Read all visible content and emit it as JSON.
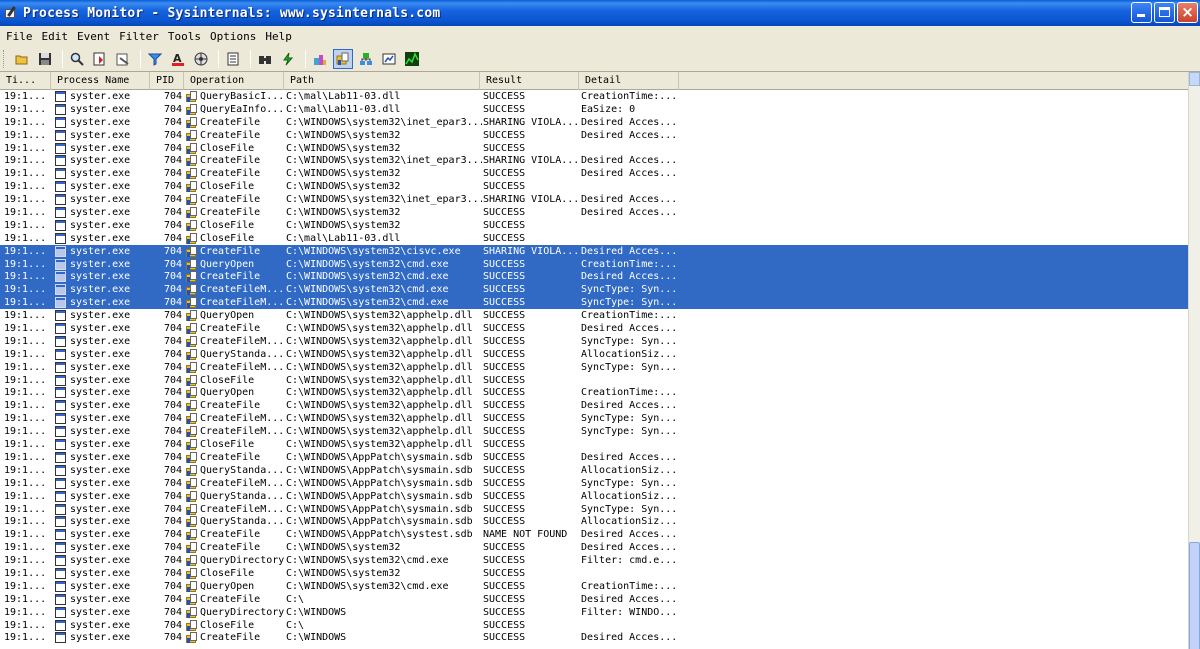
{
  "window": {
    "title": "Process Monitor - Sysinternals: www.sysinternals.com"
  },
  "menu": [
    "File",
    "Edit",
    "Event",
    "Filter",
    "Tools",
    "Options",
    "Help"
  ],
  "toolbar": {
    "buttons": [
      "open-folder-icon",
      "save-icon",
      "magnify-icon",
      "autoscroll-icon",
      "clear-icon",
      "filter-icon",
      "highlight-icon",
      "network-icon",
      "properties-icon",
      "find-icon",
      "jump-icon",
      "registry-icon",
      "filesystem-icon",
      "network-activity-icon",
      "process-activity-icon",
      "profiling-icon"
    ],
    "active_index": 12
  },
  "columns": [
    "Ti...",
    "Process Name",
    "PID",
    "Operation",
    "Path",
    "Result",
    "Detail"
  ],
  "rows": [
    {
      "time": "19:1...",
      "proc": "syster.exe",
      "pid": "704",
      "op": "QueryBasicI...",
      "path": "C:\\mal\\Lab11-03.dll",
      "result": "SUCCESS",
      "detail": "CreationTime:..."
    },
    {
      "time": "19:1...",
      "proc": "syster.exe",
      "pid": "704",
      "op": "QueryEaInfo...",
      "path": "C:\\mal\\Lab11-03.dll",
      "result": "SUCCESS",
      "detail": "EaSize: 0"
    },
    {
      "time": "19:1...",
      "proc": "syster.exe",
      "pid": "704",
      "op": "CreateFile",
      "path": "C:\\WINDOWS\\system32\\inet_epar3...",
      "result": "SHARING VIOLA...",
      "detail": "Desired Acces..."
    },
    {
      "time": "19:1...",
      "proc": "syster.exe",
      "pid": "704",
      "op": "CreateFile",
      "path": "C:\\WINDOWS\\system32",
      "result": "SUCCESS",
      "detail": "Desired Acces..."
    },
    {
      "time": "19:1...",
      "proc": "syster.exe",
      "pid": "704",
      "op": "CloseFile",
      "path": "C:\\WINDOWS\\system32",
      "result": "SUCCESS",
      "detail": ""
    },
    {
      "time": "19:1...",
      "proc": "syster.exe",
      "pid": "704",
      "op": "CreateFile",
      "path": "C:\\WINDOWS\\system32\\inet_epar3...",
      "result": "SHARING VIOLA...",
      "detail": "Desired Acces..."
    },
    {
      "time": "19:1...",
      "proc": "syster.exe",
      "pid": "704",
      "op": "CreateFile",
      "path": "C:\\WINDOWS\\system32",
      "result": "SUCCESS",
      "detail": "Desired Acces..."
    },
    {
      "time": "19:1...",
      "proc": "syster.exe",
      "pid": "704",
      "op": "CloseFile",
      "path": "C:\\WINDOWS\\system32",
      "result": "SUCCESS",
      "detail": ""
    },
    {
      "time": "19:1...",
      "proc": "syster.exe",
      "pid": "704",
      "op": "CreateFile",
      "path": "C:\\WINDOWS\\system32\\inet_epar3...",
      "result": "SHARING VIOLA...",
      "detail": "Desired Acces..."
    },
    {
      "time": "19:1...",
      "proc": "syster.exe",
      "pid": "704",
      "op": "CreateFile",
      "path": "C:\\WINDOWS\\system32",
      "result": "SUCCESS",
      "detail": "Desired Acces..."
    },
    {
      "time": "19:1...",
      "proc": "syster.exe",
      "pid": "704",
      "op": "CloseFile",
      "path": "C:\\WINDOWS\\system32",
      "result": "SUCCESS",
      "detail": ""
    },
    {
      "time": "19:1...",
      "proc": "syster.exe",
      "pid": "704",
      "op": "CloseFile",
      "path": "C:\\mal\\Lab11-03.dll",
      "result": "SUCCESS",
      "detail": ""
    },
    {
      "time": "19:1...",
      "proc": "syster.exe",
      "pid": "704",
      "op": "CreateFile",
      "path": "C:\\WINDOWS\\system32\\cisvc.exe",
      "result": "SHARING VIOLA...",
      "detail": "Desired Acces...",
      "selected": true
    },
    {
      "time": "19:1...",
      "proc": "syster.exe",
      "pid": "704",
      "op": "QueryOpen",
      "path": "C:\\WINDOWS\\system32\\cmd.exe",
      "result": "SUCCESS",
      "detail": "CreationTime:...",
      "selected": true
    },
    {
      "time": "19:1...",
      "proc": "syster.exe",
      "pid": "704",
      "op": "CreateFile",
      "path": "C:\\WINDOWS\\system32\\cmd.exe",
      "result": "SUCCESS",
      "detail": "Desired Acces...",
      "selected": true
    },
    {
      "time": "19:1...",
      "proc": "syster.exe",
      "pid": "704",
      "op": "CreateFileM...",
      "path": "C:\\WINDOWS\\system32\\cmd.exe",
      "result": "SUCCESS",
      "detail": "SyncType: Syn...",
      "selected": true
    },
    {
      "time": "19:1...",
      "proc": "syster.exe",
      "pid": "704",
      "op": "CreateFileM...",
      "path": "C:\\WINDOWS\\system32\\cmd.exe",
      "result": "SUCCESS",
      "detail": "SyncType: Syn...",
      "selected": true
    },
    {
      "time": "19:1...",
      "proc": "syster.exe",
      "pid": "704",
      "op": "QueryOpen",
      "path": "C:\\WINDOWS\\system32\\apphelp.dll",
      "result": "SUCCESS",
      "detail": "CreationTime:..."
    },
    {
      "time": "19:1...",
      "proc": "syster.exe",
      "pid": "704",
      "op": "CreateFile",
      "path": "C:\\WINDOWS\\system32\\apphelp.dll",
      "result": "SUCCESS",
      "detail": "Desired Acces..."
    },
    {
      "time": "19:1...",
      "proc": "syster.exe",
      "pid": "704",
      "op": "CreateFileM...",
      "path": "C:\\WINDOWS\\system32\\apphelp.dll",
      "result": "SUCCESS",
      "detail": "SyncType: Syn..."
    },
    {
      "time": "19:1...",
      "proc": "syster.exe",
      "pid": "704",
      "op": "QueryStanda...",
      "path": "C:\\WINDOWS\\system32\\apphelp.dll",
      "result": "SUCCESS",
      "detail": "AllocationSiz..."
    },
    {
      "time": "19:1...",
      "proc": "syster.exe",
      "pid": "704",
      "op": "CreateFileM...",
      "path": "C:\\WINDOWS\\system32\\apphelp.dll",
      "result": "SUCCESS",
      "detail": "SyncType: Syn..."
    },
    {
      "time": "19:1...",
      "proc": "syster.exe",
      "pid": "704",
      "op": "CloseFile",
      "path": "C:\\WINDOWS\\system32\\apphelp.dll",
      "result": "SUCCESS",
      "detail": ""
    },
    {
      "time": "19:1...",
      "proc": "syster.exe",
      "pid": "704",
      "op": "QueryOpen",
      "path": "C:\\WINDOWS\\system32\\apphelp.dll",
      "result": "SUCCESS",
      "detail": "CreationTime:..."
    },
    {
      "time": "19:1...",
      "proc": "syster.exe",
      "pid": "704",
      "op": "CreateFile",
      "path": "C:\\WINDOWS\\system32\\apphelp.dll",
      "result": "SUCCESS",
      "detail": "Desired Acces..."
    },
    {
      "time": "19:1...",
      "proc": "syster.exe",
      "pid": "704",
      "op": "CreateFileM...",
      "path": "C:\\WINDOWS\\system32\\apphelp.dll",
      "result": "SUCCESS",
      "detail": "SyncType: Syn..."
    },
    {
      "time": "19:1...",
      "proc": "syster.exe",
      "pid": "704",
      "op": "CreateFileM...",
      "path": "C:\\WINDOWS\\system32\\apphelp.dll",
      "result": "SUCCESS",
      "detail": "SyncType: Syn..."
    },
    {
      "time": "19:1...",
      "proc": "syster.exe",
      "pid": "704",
      "op": "CloseFile",
      "path": "C:\\WINDOWS\\system32\\apphelp.dll",
      "result": "SUCCESS",
      "detail": ""
    },
    {
      "time": "19:1...",
      "proc": "syster.exe",
      "pid": "704",
      "op": "CreateFile",
      "path": "C:\\WINDOWS\\AppPatch\\sysmain.sdb",
      "result": "SUCCESS",
      "detail": "Desired Acces..."
    },
    {
      "time": "19:1...",
      "proc": "syster.exe",
      "pid": "704",
      "op": "QueryStanda...",
      "path": "C:\\WINDOWS\\AppPatch\\sysmain.sdb",
      "result": "SUCCESS",
      "detail": "AllocationSiz..."
    },
    {
      "time": "19:1...",
      "proc": "syster.exe",
      "pid": "704",
      "op": "CreateFileM...",
      "path": "C:\\WINDOWS\\AppPatch\\sysmain.sdb",
      "result": "SUCCESS",
      "detail": "SyncType: Syn..."
    },
    {
      "time": "19:1...",
      "proc": "syster.exe",
      "pid": "704",
      "op": "QueryStanda...",
      "path": "C:\\WINDOWS\\AppPatch\\sysmain.sdb",
      "result": "SUCCESS",
      "detail": "AllocationSiz..."
    },
    {
      "time": "19:1...",
      "proc": "syster.exe",
      "pid": "704",
      "op": "CreateFileM...",
      "path": "C:\\WINDOWS\\AppPatch\\sysmain.sdb",
      "result": "SUCCESS",
      "detail": "SyncType: Syn..."
    },
    {
      "time": "19:1...",
      "proc": "syster.exe",
      "pid": "704",
      "op": "QueryStanda...",
      "path": "C:\\WINDOWS\\AppPatch\\sysmain.sdb",
      "result": "SUCCESS",
      "detail": "AllocationSiz..."
    },
    {
      "time": "19:1...",
      "proc": "syster.exe",
      "pid": "704",
      "op": "CreateFile",
      "path": "C:\\WINDOWS\\AppPatch\\systest.sdb",
      "result": "NAME NOT FOUND",
      "detail": "Desired Acces..."
    },
    {
      "time": "19:1...",
      "proc": "syster.exe",
      "pid": "704",
      "op": "CreateFile",
      "path": "C:\\WINDOWS\\system32",
      "result": "SUCCESS",
      "detail": "Desired Acces..."
    },
    {
      "time": "19:1...",
      "proc": "syster.exe",
      "pid": "704",
      "op": "QueryDirectory",
      "path": "C:\\WINDOWS\\system32\\cmd.exe",
      "result": "SUCCESS",
      "detail": "Filter: cmd.e..."
    },
    {
      "time": "19:1...",
      "proc": "syster.exe",
      "pid": "704",
      "op": "CloseFile",
      "path": "C:\\WINDOWS\\system32",
      "result": "SUCCESS",
      "detail": ""
    },
    {
      "time": "19:1...",
      "proc": "syster.exe",
      "pid": "704",
      "op": "QueryOpen",
      "path": "C:\\WINDOWS\\system32\\cmd.exe",
      "result": "SUCCESS",
      "detail": "CreationTime:..."
    },
    {
      "time": "19:1...",
      "proc": "syster.exe",
      "pid": "704",
      "op": "CreateFile",
      "path": "C:\\",
      "result": "SUCCESS",
      "detail": "Desired Acces..."
    },
    {
      "time": "19:1...",
      "proc": "syster.exe",
      "pid": "704",
      "op": "QueryDirectory",
      "path": "C:\\WINDOWS",
      "result": "SUCCESS",
      "detail": "Filter: WINDO..."
    },
    {
      "time": "19:1...",
      "proc": "syster.exe",
      "pid": "704",
      "op": "CloseFile",
      "path": "C:\\",
      "result": "SUCCESS",
      "detail": ""
    },
    {
      "time": "19:1...",
      "proc": "syster.exe",
      "pid": "704",
      "op": "CreateFile",
      "path": "C:\\WINDOWS",
      "result": "SUCCESS",
      "detail": "Desired Acces..."
    }
  ],
  "colors": {
    "selection": "#316ac5",
    "titlebar": "#0a5fd8",
    "chrome": "#ece9d8"
  }
}
